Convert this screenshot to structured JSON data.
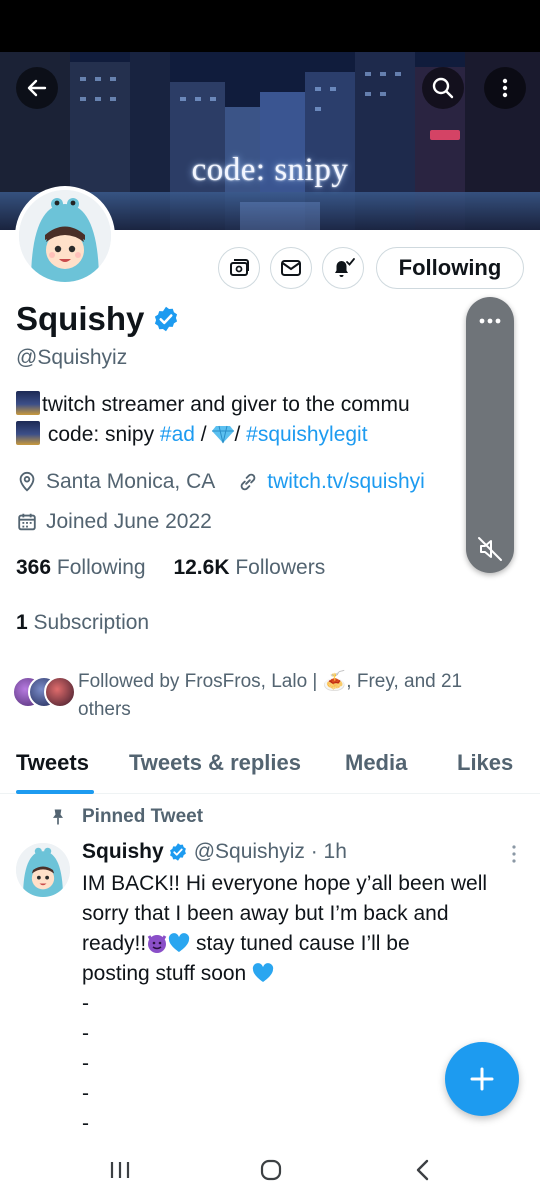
{
  "banner": {
    "text": "code: snipy"
  },
  "profile": {
    "name": "Squishy",
    "handle": "@Squishyiz",
    "bio_line1": "twitch streamer and giver to the commu",
    "bio_line2_prefix": " code: snipy ",
    "bio_tag_ad": "#ad",
    "bio_sep1": " / ",
    "bio_sep2": "/ ",
    "bio_tag_legit": "#squishylegit",
    "location": "Santa Monica, CA",
    "website": "twitch.tv/squishyi",
    "joined": "Joined June 2022",
    "following_label": "Following"
  },
  "stats": {
    "following_count": "366",
    "following_label": "Following",
    "followers_count": "12.6K",
    "followers_label": "Followers",
    "subscription_count": "1",
    "subscription_label": "Subscription"
  },
  "followed_by": "Followed by FrosFros, Lalo | 🍝, Frey, and 21 others",
  "tabs": [
    {
      "label": "Tweets"
    },
    {
      "label": "Tweets & replies"
    },
    {
      "label": "Media"
    },
    {
      "label": "Likes"
    }
  ],
  "pinned_tweet": {
    "label": "Pinned Tweet",
    "author": "Squishy",
    "meta": "@Squishyiz · 1h",
    "line1": "IM BACK!! Hi everyone hope y’all been well",
    "line2": "sorry that I been away but I’m back and",
    "line3_prefix": "ready!!",
    "line3_suffix": " stay tuned cause I’ll be",
    "line4": "posting stuff soon ",
    "dash": "-"
  },
  "icons": {
    "back": "back-arrow-icon",
    "search": "search-icon",
    "more": "more-vertical-icon",
    "subscriptions": "subscriptions-icon",
    "message": "envelope-icon",
    "notifications": "bell-check-icon",
    "verified": "verified-badge-icon",
    "location": "location-pin-icon",
    "link": "link-icon",
    "calendar": "calendar-icon",
    "pin": "pin-icon",
    "compose": "plus-icon",
    "mute": "speaker-muted-icon"
  },
  "colors": {
    "accent": "#1d9bf0",
    "text": "#0f1419",
    "secondary": "#536471"
  }
}
